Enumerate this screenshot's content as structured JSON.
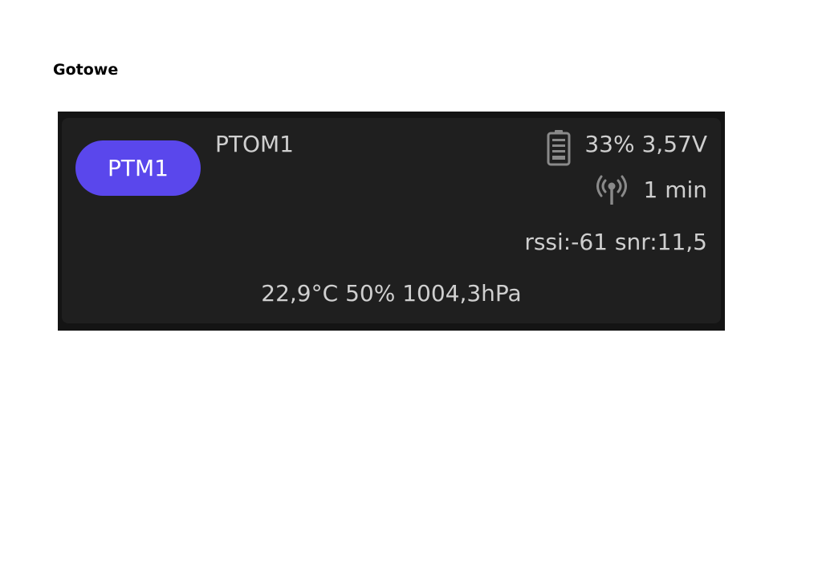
{
  "heading": "Gotowe",
  "device": {
    "chip_label": "PTM1",
    "chip_color": "#5a47ec",
    "name": "PTOM1",
    "battery": "33% 3,57V",
    "battery_icon": "battery-icon",
    "last_seen": "1 min",
    "signal_icon": "signal-antenna-icon",
    "rssi_snr": "rssi:-61 snr:11,5",
    "readings": "22,9°C 50% 1004,3hPa"
  },
  "colors": {
    "card_background": "#1f1f1f",
    "frame_background": "#141414",
    "text": "#cfcfcf",
    "icon": "#8a8a8a"
  }
}
